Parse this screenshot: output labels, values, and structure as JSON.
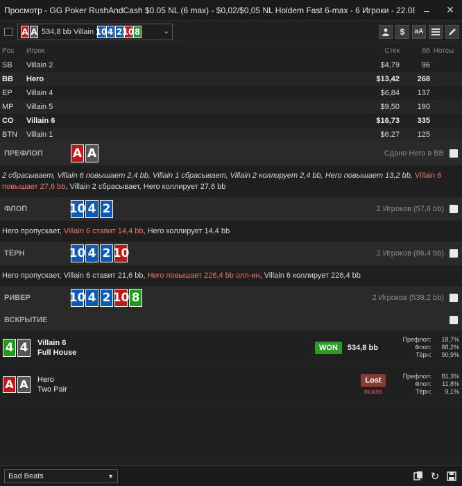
{
  "window": {
    "title": "Просмотр - GG Poker RushAndCash $0.05 NL (6 max) - $0,02/$0,05 NL Holdem Fast 6-max  - 6 Игроки - 22.08.2026 ..."
  },
  "toolbar": {
    "hand_label": "534,8 bb Villain 6",
    "hero_cards": [
      {
        "rank": "A",
        "suit": "h"
      },
      {
        "rank": "A",
        "suit": "s"
      }
    ],
    "board_cards": [
      {
        "rank": "10",
        "suit": "d"
      },
      {
        "rank": "4",
        "suit": "d"
      },
      {
        "rank": "2",
        "suit": "d"
      },
      {
        "rank": "10",
        "suit": "h"
      },
      {
        "rank": "8",
        "suit": "c"
      }
    ],
    "buttons": [
      "user-icon",
      "dollar-icon",
      "font-size-icon",
      "list-icon",
      "edit-icon"
    ],
    "dollar_glyph": "$",
    "font_glyph": "aA"
  },
  "players_table": {
    "headers": {
      "pos": "Pos",
      "player": "Игрок",
      "stack": "Стек",
      "bb": "бб",
      "notes": "Нотсы"
    },
    "rows": [
      {
        "pos": "SB",
        "name": "Villain 2",
        "stack": "$4,79",
        "bb": "96",
        "bold": false
      },
      {
        "pos": "BB",
        "name": "Hero",
        "stack": "$13,42",
        "bb": "268",
        "bold": true
      },
      {
        "pos": "EP",
        "name": "Villain 4",
        "stack": "$6,84",
        "bb": "137",
        "bold": false
      },
      {
        "pos": "MP",
        "name": "Villain 5",
        "stack": "$9,50",
        "bb": "190",
        "bold": false
      },
      {
        "pos": "CO",
        "name": "Villain 6",
        "stack": "$16,73",
        "bb": "335",
        "bold": true
      },
      {
        "pos": "BTN",
        "name": "Villain 1",
        "stack": "$6,27",
        "bb": "125",
        "bold": false
      }
    ]
  },
  "streets": {
    "preflop": {
      "name": "ПРЕФЛОП",
      "info": "Сдано Hero в BB",
      "cards": [
        {
          "rank": "A",
          "suit": "h"
        },
        {
          "rank": "A",
          "suit": "s"
        }
      ],
      "actions_a": "2 сбрасывает, Villain 6 повышает 2,4 bb, Villain 1 сбрасывает, Villain 2 коллирует 2,4 bb, Hero повышает 13,2 bb, ",
      "actions_hl": "Villain 6 повышает 27,6 bb",
      "actions_b": ", Villain 2 сбрасывает, Hero коллирует 27,6 bb"
    },
    "flop": {
      "name": "ФЛОП",
      "info": "2 Игроков (57,6 bb)",
      "cards": [
        {
          "rank": "10",
          "suit": "d"
        },
        {
          "rank": "4",
          "suit": "d"
        },
        {
          "rank": "2",
          "suit": "d"
        }
      ],
      "actions_a": "Hero пропускает, ",
      "actions_hl": "Villain 6 ставит 14,4 bb",
      "actions_b": ", Hero коллирует 14,4 bb"
    },
    "turn": {
      "name": "ТЁРН",
      "info": "2 Игроков (86,4 bb)",
      "cards": [
        {
          "rank": "10",
          "suit": "d"
        },
        {
          "rank": "4",
          "suit": "d"
        },
        {
          "rank": "2",
          "suit": "d"
        },
        {
          "rank": "10",
          "suit": "h"
        }
      ],
      "actions_a": "Hero пропускает, Villain 6 ставит 21,6 bb, ",
      "actions_hl": "Hero повышает 226,4 bb олл-ин",
      "actions_b": ", Villain 6 коллирует 226,4 bb"
    },
    "river": {
      "name": "РИВЕР",
      "info": "2 Игроков (539,2 bb)",
      "cards": [
        {
          "rank": "10",
          "suit": "d"
        },
        {
          "rank": "4",
          "suit": "d"
        },
        {
          "rank": "2",
          "suit": "d"
        },
        {
          "rank": "10",
          "suit": "h"
        },
        {
          "rank": "8",
          "suit": "c"
        }
      ]
    },
    "showdown": {
      "name": "ВСКРЫТИЕ"
    }
  },
  "showdown": [
    {
      "name": "Villain 6",
      "hand": "Full House",
      "cards": [
        {
          "rank": "4",
          "suit": "c"
        },
        {
          "rank": "4",
          "suit": "s"
        }
      ],
      "result": "WON",
      "amount": "534,8 bb",
      "stats": [
        [
          "Префлоп:",
          "18,7%"
        ],
        [
          "Флоп:",
          "88,2%"
        ],
        [
          "Тёрн:",
          "90,9%"
        ]
      ]
    },
    {
      "name": "Hero",
      "hand": "Two Pair",
      "cards": [
        {
          "rank": "A",
          "suit": "h"
        },
        {
          "rank": "A",
          "suit": "s"
        }
      ],
      "result": "Lost",
      "sub": "mucks",
      "stats": [
        [
          "Префлоп:",
          "81,3%"
        ],
        [
          "Флоп:",
          "11,8%"
        ],
        [
          "Тёрн:",
          "9,1%"
        ]
      ]
    }
  ],
  "bottom": {
    "filter_select": "Bad Beats",
    "icons": [
      "copy-icon",
      "refresh-icon",
      "save-icon"
    ]
  },
  "colors": {
    "hearts": "#c01818",
    "spades": "#555555",
    "diamonds": "#0c5bb8",
    "clubs": "#1f9a1f",
    "won": "#2f9a2a",
    "lost": "#8a3a30"
  }
}
